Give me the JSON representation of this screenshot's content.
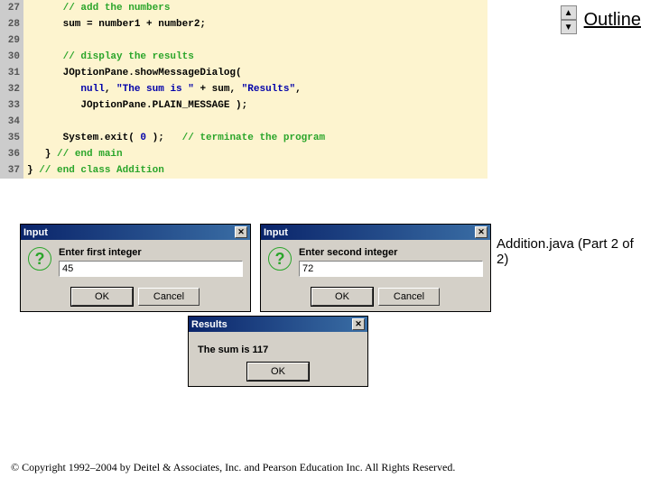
{
  "code": {
    "lines": [
      {
        "n": "27",
        "cls": "cm",
        "text": "      // add the numbers"
      },
      {
        "n": "28",
        "cls": "kw",
        "text": "      sum = number1 + number2;"
      },
      {
        "n": "29",
        "cls": "",
        "text": ""
      },
      {
        "n": "30",
        "cls": "cm",
        "text": "      // display the results"
      },
      {
        "n": "31",
        "cls": "kw",
        "text": "      JOptionPane.showMessageDialog("
      },
      {
        "n": "32",
        "cls": "mx1",
        "text": ""
      },
      {
        "n": "33",
        "cls": "mx2",
        "text": ""
      },
      {
        "n": "34",
        "cls": "",
        "text": ""
      },
      {
        "n": "35",
        "cls": "mx3",
        "text": ""
      },
      {
        "n": "36",
        "cls": "mx4",
        "text": ""
      },
      {
        "n": "37",
        "cls": "mx5",
        "text": ""
      }
    ],
    "l32": {
      "a": "         null",
      "b": ", ",
      "c": "\"The sum is \"",
      "d": " + sum, ",
      "e": "\"Results\"",
      "f": ","
    },
    "l33": {
      "a": "         JOptionPane.PLAIN_MESSAGE );"
    },
    "l35": {
      "a": "      System.exit( ",
      "b": "0",
      "c": " );",
      "d": "   // terminate the program"
    },
    "l36": {
      "a": "   } ",
      "b": "// end main"
    },
    "l37": {
      "a": "} ",
      "b": "// end class Addition"
    }
  },
  "outline": "Outline",
  "caption": "Addition.java (Part 2 of 2)",
  "dialog1": {
    "title": "Input",
    "prompt": "Enter first integer",
    "value": "45",
    "ok": "OK",
    "cancel": "Cancel"
  },
  "dialog2": {
    "title": "Input",
    "prompt": "Enter second integer",
    "value": "72",
    "ok": "OK",
    "cancel": "Cancel"
  },
  "resultsDialog": {
    "title": "Results",
    "msg": "The sum is 117",
    "ok": "OK"
  },
  "copyright": "© Copyright 1992–2004 by Deitel & Associates, Inc. and Pearson Education Inc. All Rights Reserved."
}
